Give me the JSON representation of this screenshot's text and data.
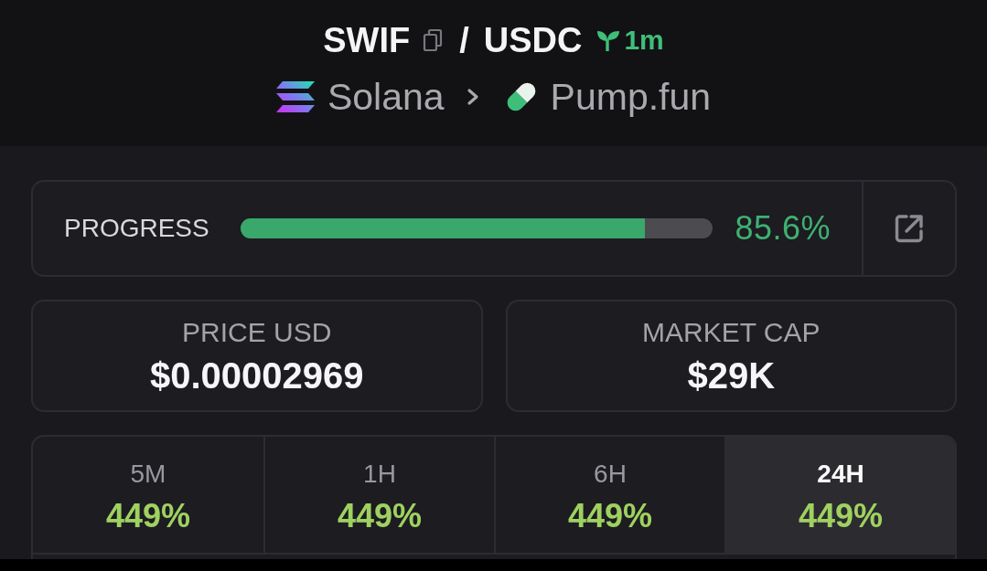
{
  "header": {
    "base_symbol": "SWIF",
    "separator": "/",
    "quote_symbol": "USDC",
    "age": "1m",
    "chain": "Solana",
    "platform": "Pump.fun"
  },
  "progress": {
    "label": "PROGRESS",
    "level": 0.856,
    "reading": "85.6%"
  },
  "stats": [
    {
      "label": "PRICE USD",
      "value": "$0.00002969"
    },
    {
      "label": "MARKET CAP",
      "value": "$29K"
    }
  ],
  "timeframes": [
    {
      "label": "5M",
      "change": "449%",
      "selected": false
    },
    {
      "label": "1H",
      "change": "449%",
      "selected": false
    },
    {
      "label": "6H",
      "change": "449%",
      "selected": false
    },
    {
      "label": "24H",
      "change": "449%",
      "selected": true
    }
  ]
}
